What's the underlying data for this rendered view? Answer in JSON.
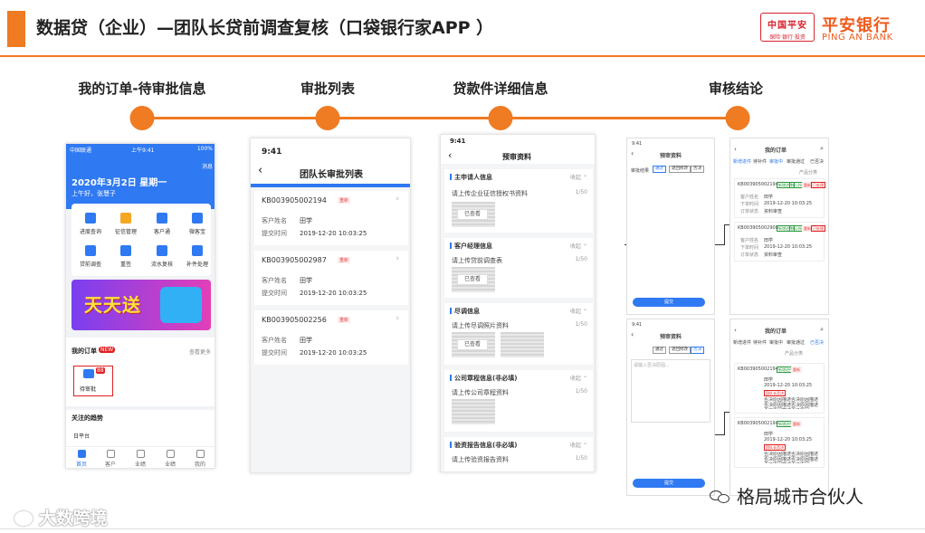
{
  "slide": {
    "title": "数据贷（企业）—团队长贷前调查复核（口袋银行家APP ）"
  },
  "logo": {
    "box_top": "中国平安",
    "box_bottom": "保险·银行·投资",
    "name_cn": "平安银行",
    "name_en": "PING AN BANK"
  },
  "colors": {
    "accent": "#ef7b22",
    "blue": "#2f79f2",
    "brand_red": "#d9232e"
  },
  "steps": [
    {
      "label": "我的订单-待审批信息"
    },
    {
      "label": "审批列表"
    },
    {
      "label": "贷款件详细信息"
    },
    {
      "label": "审核结论"
    }
  ],
  "screen1": {
    "carrier": "中国联通",
    "time": "上午9:41",
    "battery": "100%",
    "msg": "消息",
    "date": "2020年3月2日  星期一",
    "greeting": "上午好，张慧子",
    "icons": [
      {
        "label": "进度查询",
        "icon": "doc-icon"
      },
      {
        "label": "征信管理",
        "icon": "shield-icon"
      },
      {
        "label": "客户通",
        "icon": "doc-icon"
      },
      {
        "label": "微客宝",
        "icon": "doc-icon"
      },
      {
        "label": "贷前调查",
        "icon": "doc-icon"
      },
      {
        "label": "重签",
        "icon": "doc-icon"
      },
      {
        "label": "流水复核",
        "icon": "doc-icon"
      },
      {
        "label": "补件处理",
        "icon": "person-icon"
      }
    ],
    "banner": "天天送",
    "orders_title": "我的订单",
    "orders_badge": "NEW",
    "see_more": "查看更多",
    "pending_label": "待审批",
    "pending_badge": "88",
    "trend_title": "关注的趋势",
    "trend_item": "日平台",
    "tabs": [
      "首页",
      "客户",
      "业绩",
      "业绩",
      "我的"
    ]
  },
  "screen2": {
    "time": "9:41",
    "title": "团队长审批列表",
    "badge": "重新",
    "customer_label": "客户姓名",
    "submit_label": "提交时间",
    "items": [
      {
        "code": "KB003905002194",
        "customer": "田学",
        "time": "2019-12-20  10:03:25"
      },
      {
        "code": "KB003905002987",
        "customer": "田学",
        "time": "2019-12-20  10:03:25"
      },
      {
        "code": "KB003905002256",
        "customer": "田学",
        "time": "2019-12-20  10:03:25"
      }
    ]
  },
  "screen3": {
    "time": "9:41",
    "title": "预审资料",
    "collapse": "收起",
    "viewed": "已查看",
    "sections": [
      {
        "head": "主申请人信息",
        "line": "请上传企业征信授权书资料",
        "count": "1/50"
      },
      {
        "head": "客户经理信息",
        "line": "请上传贷前调查表",
        "count": "1/50"
      },
      {
        "head": "尽调信息",
        "line": "请上传尽调照片资料",
        "count": "1/50"
      },
      {
        "head": "公司章程信息(非必填)",
        "line": "请上传公司章程资料",
        "count": "1/50"
      },
      {
        "head": "验资报告信息(非必填)",
        "line": "请上传验资报告资料",
        "count": "1/50"
      }
    ]
  },
  "screen4": {
    "time": "9:41",
    "title": "预审资料",
    "review_label": "审批结果",
    "options": [
      "通过",
      "退回修改",
      "否决"
    ],
    "submit": "提交"
  },
  "screen5": {
    "title": "我的订单",
    "tabs": [
      "新增进件",
      "待补件",
      "审批中",
      "审批通过",
      "已否决"
    ],
    "filter": "产品分类",
    "cards": [
      {
        "code": "KB003905002194",
        "tag1": "新增进件",
        "tag2": "核心授权",
        "badge": "重新",
        "flag": "已处理",
        "customer_label": "客户姓名",
        "customer": "田学",
        "time_label": "下单时间",
        "time": "2019-12-20  10:03:25",
        "status_label": "订单状态",
        "status": "资料审查"
      },
      {
        "code": "KB003905002908",
        "tag1": "新增进件",
        "tag2": "核心授权",
        "badge": "重新",
        "flag": "已处理",
        "customer_label": "客户姓名",
        "customer": "田学",
        "time_label": "下单时间",
        "time": "2019-12-20  10:03:25",
        "status_label": "订单状态",
        "status": "资料审查"
      }
    ]
  },
  "screen6": {
    "time": "9:41",
    "title": "预审资料",
    "options": [
      "通过",
      "退回修改",
      "否决"
    ],
    "placeholder": "请输入否决原因...",
    "submit": "提交"
  },
  "screen7": {
    "title": "我的订单",
    "tabs": [
      "新增进件",
      "待补件",
      "审批中",
      "审批通过",
      "已否决"
    ],
    "filter": "产品分类",
    "cards": [
      {
        "code": "KB003905002194",
        "tag1": "新增进件",
        "badge": "重新",
        "customer": "田学",
        "time": "2019-12-20  10:03:25",
        "result": "团队长否决",
        "reason": "否决原因描述否决原因描述否决原因描述否决原因描述否决原因描述否决原因..."
      },
      {
        "code": "KB003905002194",
        "tag1": "新增进件",
        "badge": "重新",
        "customer": "田学",
        "time": "2019-12-20  10:03:25",
        "result": "团队长否决",
        "reason": "否决原因描述否决原因描述否决原因描述否决原因描述否决原因描述否决原因..."
      }
    ]
  },
  "footer": {
    "left_watermark": "大数跨境",
    "right_watermark": "格局城市合伙人"
  }
}
